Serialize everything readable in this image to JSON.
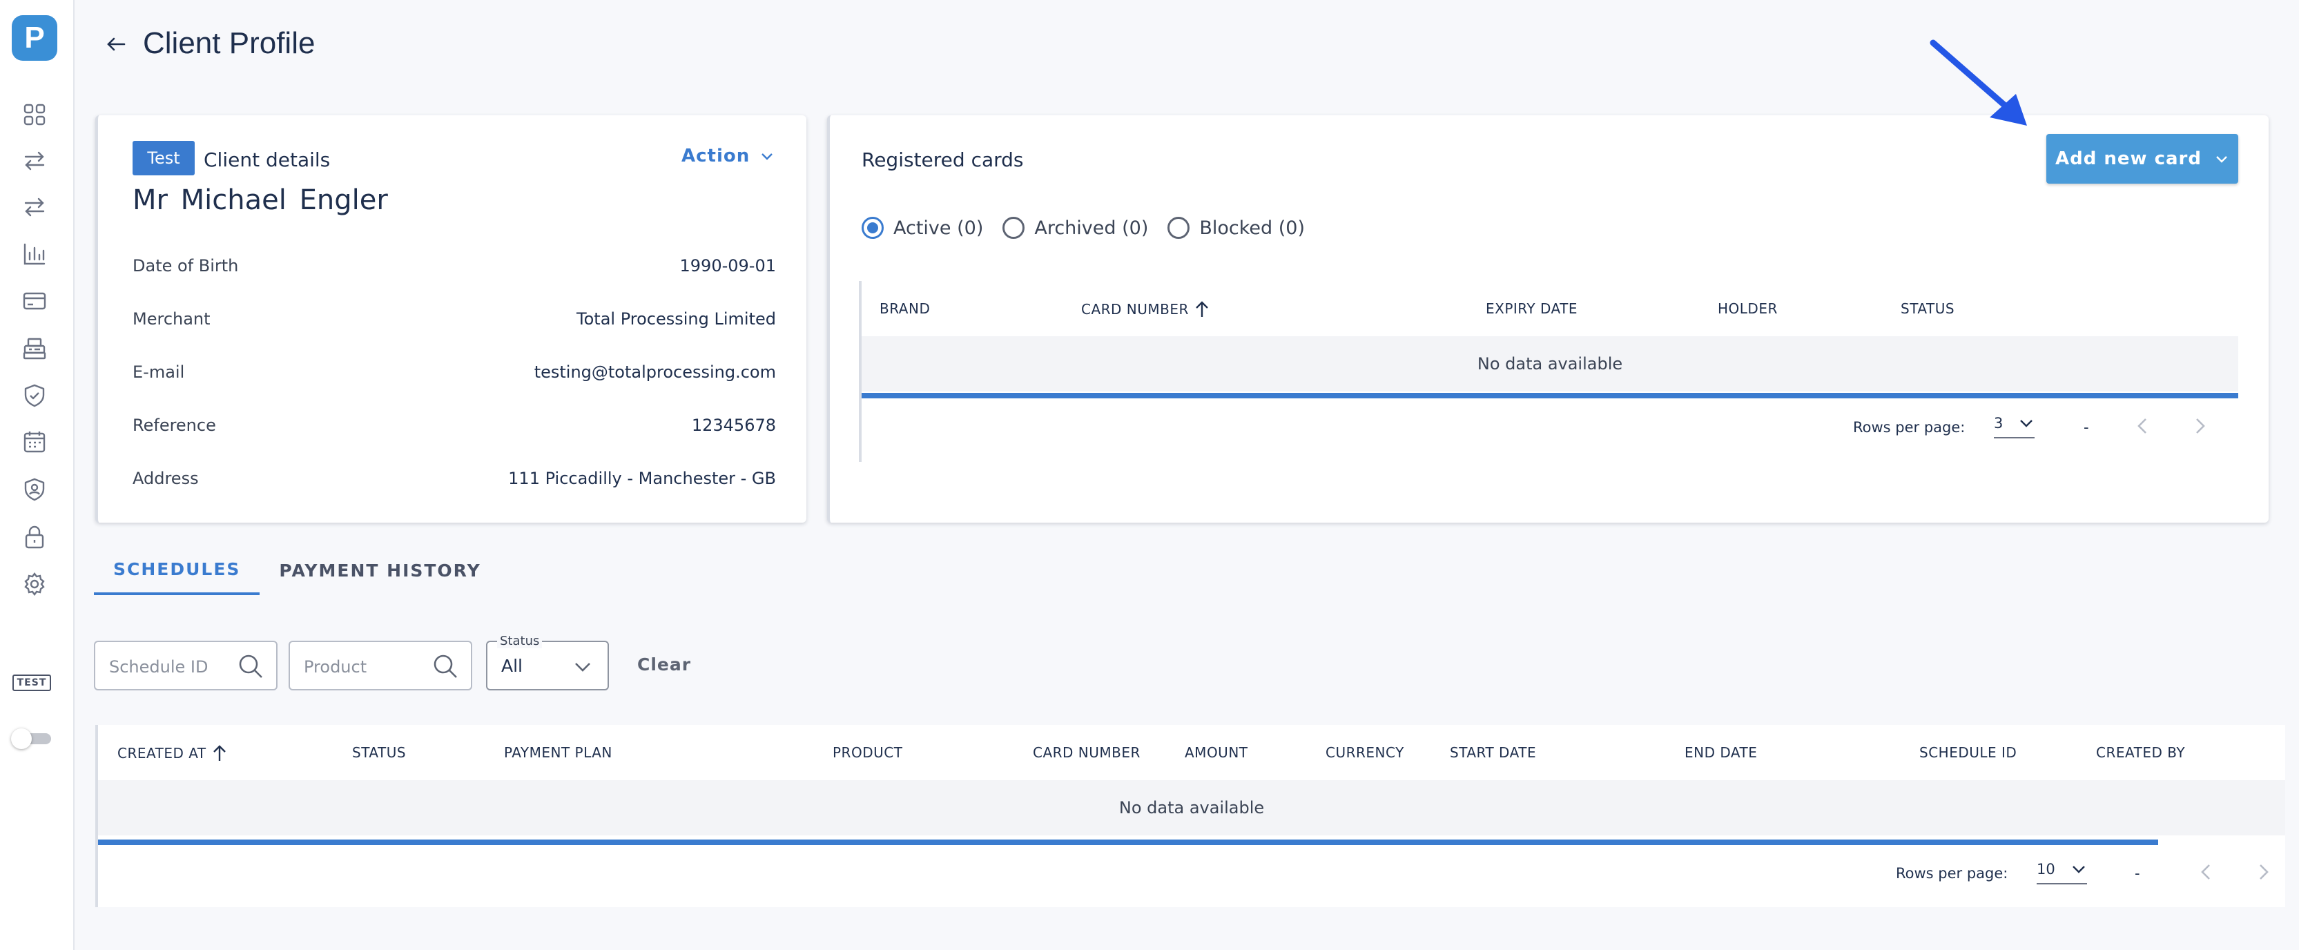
{
  "sidebar": {
    "logo": "P",
    "icons": [
      "dashboard-icon",
      "transfer-icon",
      "transfer-alt-icon",
      "chart-icon",
      "card-icon",
      "terminal-icon",
      "shield-check-icon",
      "calendar-icon",
      "user-shield-icon",
      "lock-icon",
      "gear-icon"
    ],
    "env_tag": "TEST"
  },
  "header": {
    "title": "Client Profile"
  },
  "client": {
    "badge": "Test",
    "section_title": "Client details",
    "action_label": "Action",
    "name": "Mr  Michael  Engler",
    "rows": [
      {
        "label": "Date of Birth",
        "value": "1990-09-01"
      },
      {
        "label": "Merchant",
        "value": "Total Processing Limited"
      },
      {
        "label": "E-mail",
        "value": "testing@totalprocessing.com"
      },
      {
        "label": "Reference",
        "value": "12345678"
      },
      {
        "label": "Address",
        "value": "111 Piccadilly - Manchester - GB"
      }
    ]
  },
  "cards": {
    "title": "Registered cards",
    "add_button": "Add new card",
    "filters": [
      {
        "label": "Active (0)",
        "selected": true
      },
      {
        "label": "Archived (0)",
        "selected": false
      },
      {
        "label": "Blocked (0)",
        "selected": false
      }
    ],
    "columns": [
      "BRAND",
      "CARD NUMBER",
      "EXPIRY DATE",
      "HOLDER",
      "STATUS"
    ],
    "empty_text": "No data available",
    "rows_per_page_label": "Rows per page:",
    "rows_per_page": "3",
    "range": "-"
  },
  "tabs": [
    {
      "label": "SCHEDULES",
      "active": true
    },
    {
      "label": "PAYMENT HISTORY",
      "active": false
    }
  ],
  "filters": {
    "schedule_id_placeholder": "Schedule ID",
    "product_placeholder": "Product",
    "status_label": "Status",
    "status_value": "All",
    "clear_label": "Clear"
  },
  "schedules": {
    "columns": [
      "CREATED AT",
      "STATUS",
      "PAYMENT PLAN",
      "PRODUCT",
      "CARD NUMBER",
      "AMOUNT",
      "CURRENCY",
      "START DATE",
      "END DATE",
      "SCHEDULE ID",
      "CREATED BY"
    ],
    "empty_text": "No data available",
    "rows_per_page_label": "Rows per page:",
    "rows_per_page": "10",
    "range": "-"
  },
  "colors": {
    "accent": "#3a7bcf",
    "button": "#4a9bd9",
    "annotation_arrow": "#2457e6"
  }
}
